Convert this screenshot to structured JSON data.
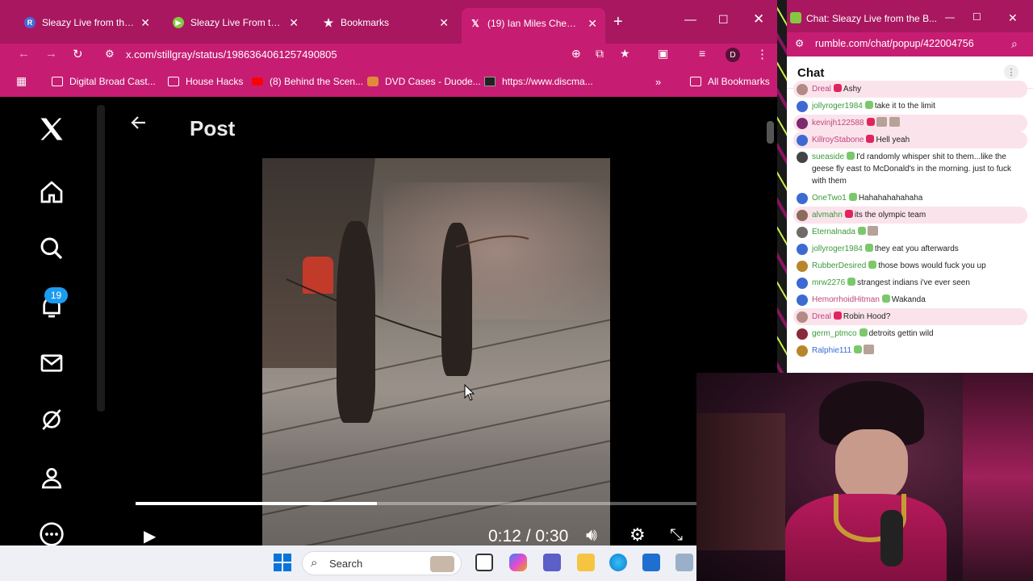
{
  "browser": {
    "tabs": [
      {
        "label": "Sleazy Live from the Bu",
        "icon": "R",
        "color": "#4a67d6"
      },
      {
        "label": "Sleazy Live From the Bu",
        "icon": "rumble",
        "color": "#85c742"
      },
      {
        "label": "Bookmarks",
        "icon": "star",
        "color": ""
      },
      {
        "label": "(19) Ian Miles Cheong c",
        "icon": "X",
        "color": ""
      }
    ],
    "url": "x.com/stillgray/status/1986364061257490805",
    "bookmarks": [
      "Digital Broad Cast...",
      "House Hacks",
      "(8) Behind the Scen...",
      "DVD Cases - Duode...",
      "https://www.discma..."
    ],
    "all_bookmarks": "All Bookmarks",
    "profile_initial": "D"
  },
  "xpage": {
    "title": "Post",
    "notification_count": "19",
    "video_time": "0:12 / 0:30",
    "video_progress": 0.43
  },
  "chat": {
    "window_title": "Chat: Sleazy Live from the B...",
    "url": "rumble.com/chat/popup/422004756",
    "heading": "Chat",
    "messages": [
      {
        "user": "Dreal",
        "text": "Ashy",
        "color": "#c0477a",
        "hl": true,
        "av": "#b48a84"
      },
      {
        "user": "jollyroger1984",
        "text": "take it to the limit",
        "color": "#3a9a3a",
        "hl": false,
        "av": "#3c6ad2"
      },
      {
        "user": "kevinjh122588",
        "text": "",
        "color": "#c0477a",
        "hl": true,
        "av": "#7d2a6e",
        "emotes": 2
      },
      {
        "user": "KillroyStabone",
        "text": "Hell yeah",
        "color": "#c0477a",
        "hl": true,
        "av": "#3c6ad2"
      },
      {
        "user": "sueaside",
        "text": "I'd randomly whisper shit to them...like the geese fly east to McDonald's in the morning. just to fuck with them",
        "color": "#3a9a3a",
        "hl": false,
        "av": "#444"
      },
      {
        "user": "OneTwo1",
        "text": "Hahahahahahaha",
        "color": "#3a9a3a",
        "hl": false,
        "av": "#3c6ad2"
      },
      {
        "user": "alvmahn",
        "text": "its the olympic team",
        "color": "#3a9a3a",
        "hl": true,
        "av": "#8a6b5c"
      },
      {
        "user": "Eternalnada",
        "text": "",
        "color": "#3a9a3a",
        "hl": false,
        "av": "#6f6a66",
        "emotes": 1
      },
      {
        "user": "jollyroger1984",
        "text": "they eat you afterwards",
        "color": "#3a9a3a",
        "hl": false,
        "av": "#3c6ad2"
      },
      {
        "user": "RubberDesired",
        "text": "those bows would fuck you up",
        "color": "#3a9a3a",
        "hl": false,
        "av": "#b8862a"
      },
      {
        "user": "mrw2276",
        "text": "strangest indians i've ever seen",
        "color": "#3a9a3a",
        "hl": false,
        "av": "#3c6ad2"
      },
      {
        "user": "HemorrhoidHitman",
        "text": "Wakanda",
        "color": "#c0477a",
        "hl": false,
        "av": "#3c6ad2"
      },
      {
        "user": "Dreal",
        "text": "Robin Hood?",
        "color": "#c0477a",
        "hl": true,
        "av": "#b48a84"
      },
      {
        "user": "germ_ptmco",
        "text": "detroits gettin wild",
        "color": "#3a9a3a",
        "hl": false,
        "av": "#8a2a3a"
      },
      {
        "user": "Ralphie111",
        "text": "",
        "color": "#3c6ad2",
        "hl": false,
        "av": "#b8862a",
        "emotes": 1
      }
    ]
  },
  "taskbar": {
    "search_placeholder": "Search"
  }
}
